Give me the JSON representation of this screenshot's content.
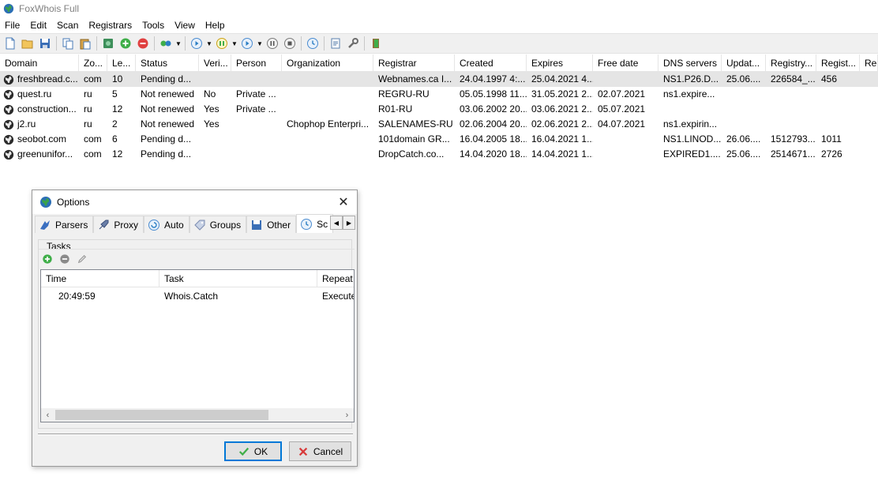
{
  "window": {
    "title": "FoxWhois Full"
  },
  "menu": [
    "File",
    "Edit",
    "Scan",
    "Registrars",
    "Tools",
    "View",
    "Help"
  ],
  "toolbar": {
    "icons": [
      "new-file-icon",
      "open-folder-icon",
      "save-icon",
      "copy-icon",
      "paste-icon",
      "import-icon",
      "add-icon",
      "remove-icon",
      "connect-icon",
      "start-icon",
      "pause-scan-icon",
      "play-icon",
      "pause-icon",
      "stop-icon",
      "schedule-icon",
      "report-icon",
      "settings-icon",
      "exit-icon"
    ]
  },
  "table": {
    "columns": [
      "Domain",
      "Zo...",
      "Le...",
      "Status",
      "Veri...",
      "Person",
      "Organization",
      "Registrar",
      "Created",
      "Expires",
      "Free date",
      "DNS servers",
      "Updat...",
      "Registry...",
      "Regist...",
      "Rec"
    ],
    "rows": [
      [
        "freshbread.c...",
        "com",
        "10",
        "Pending d...",
        "",
        "",
        "",
        "Webnames.ca I...",
        "24.04.1997 4:...",
        "25.04.2021 4...",
        "",
        "NS1.P26.D...",
        "25.06....",
        "226584_...",
        "456",
        ""
      ],
      [
        "quest.ru",
        "ru",
        "5",
        "Not renewed",
        "No",
        "Private ...",
        "",
        "REGRU-RU",
        "05.05.1998 11...",
        "31.05.2021 2...",
        "02.07.2021",
        "ns1.expire...",
        "",
        "",
        "",
        ""
      ],
      [
        "construction...",
        "ru",
        "12",
        "Not renewed",
        "Yes",
        "Private ...",
        "",
        "R01-RU",
        "03.06.2002 20...",
        "03.06.2021 2...",
        "05.07.2021",
        "",
        "",
        "",
        "",
        ""
      ],
      [
        "j2.ru",
        "ru",
        "2",
        "Not renewed",
        "Yes",
        "",
        "Chophop Enterpri...",
        "SALENAMES-RU",
        "02.06.2004 20...",
        "02.06.2021 2...",
        "04.07.2021",
        "ns1.expirin...",
        "",
        "",
        "",
        ""
      ],
      [
        "seobot.com",
        "com",
        "6",
        "Pending d...",
        "",
        "",
        "",
        "101domain GR...",
        "16.04.2005 18...",
        "16.04.2021 1...",
        "",
        "NS1.LINOD...",
        "26.06....",
        "1512793...",
        "1011",
        ""
      ],
      [
        "greenunifor...",
        "com",
        "12",
        "Pending d...",
        "",
        "",
        "",
        "DropCatch.co...",
        "14.04.2020 18...",
        "14.04.2021 1...",
        "",
        "EXPIRED1....",
        "25.06....",
        "2514671...",
        "2726",
        ""
      ]
    ]
  },
  "dialog": {
    "title": "Options",
    "tabs": [
      "Parsers",
      "Proxy",
      "Auto",
      "Groups",
      "Other",
      "Sc"
    ],
    "group_label": "Tasks",
    "tasks": {
      "columns": [
        "Time",
        "Task",
        "Repeat"
      ],
      "rows": [
        [
          "20:49:59",
          "Whois.Catch",
          "Execute"
        ]
      ]
    },
    "ok_label": "OK",
    "cancel_label": "Cancel"
  }
}
